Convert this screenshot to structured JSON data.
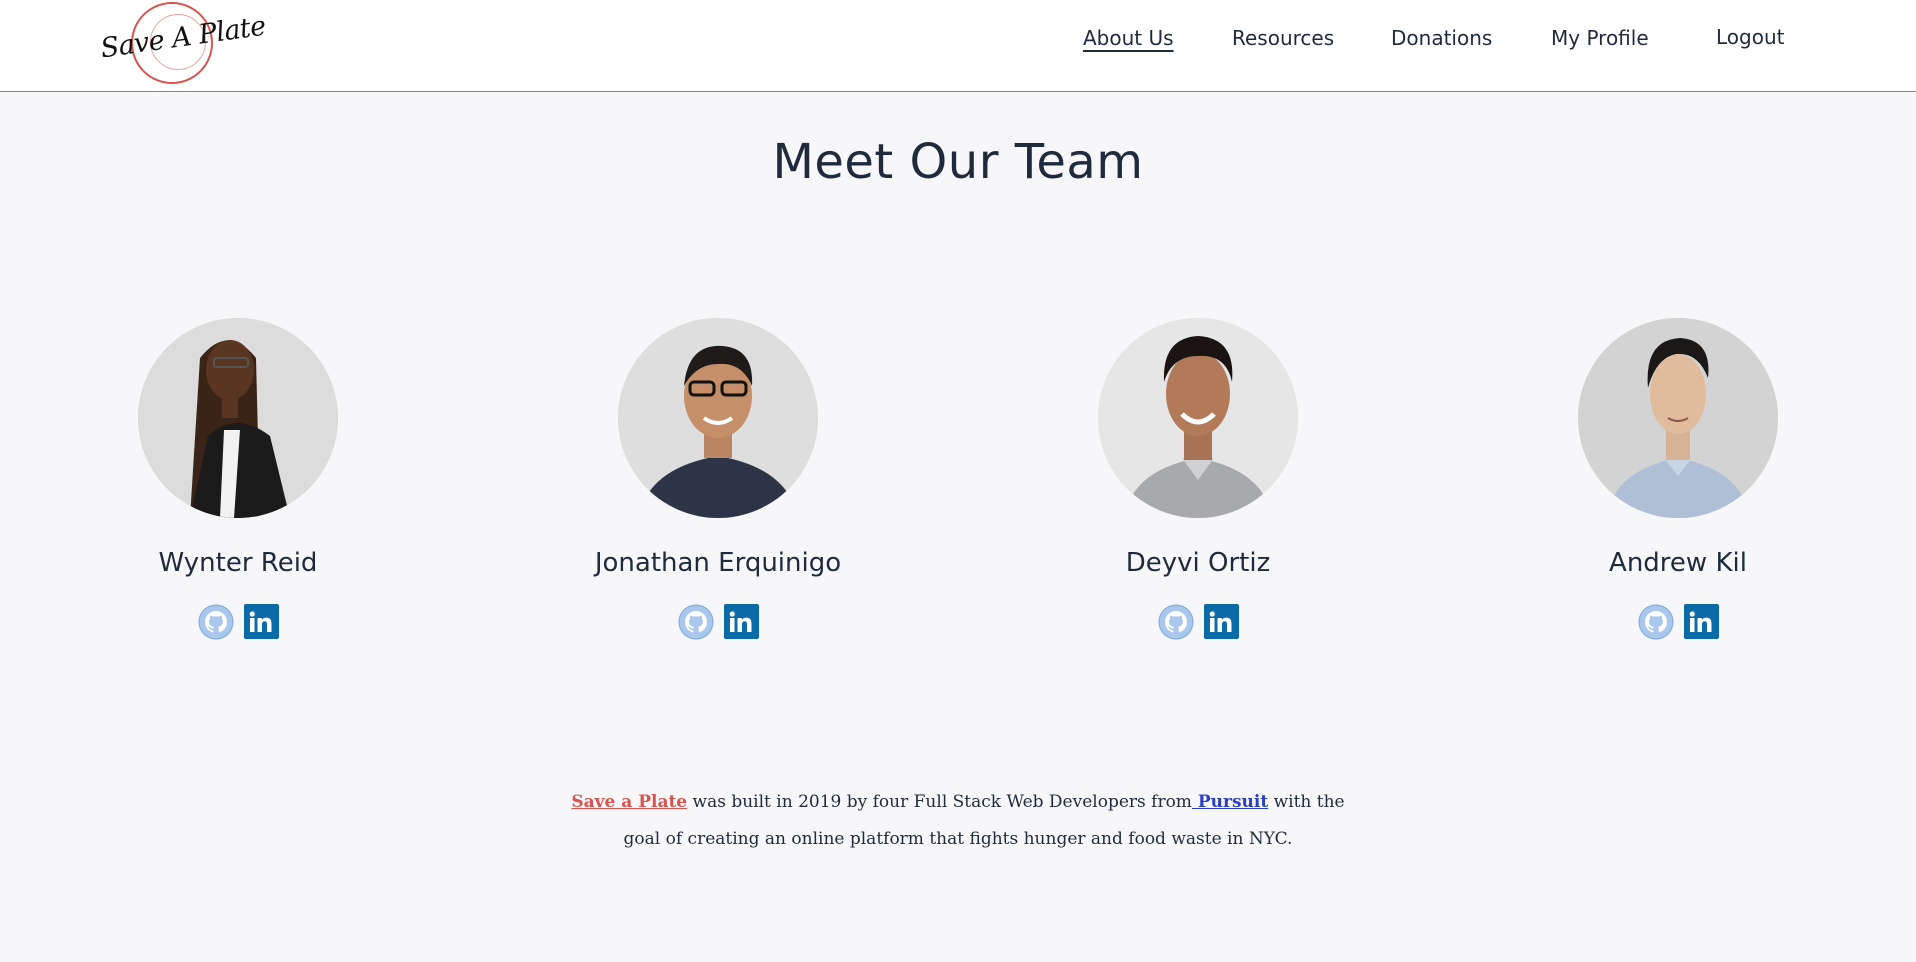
{
  "brand": {
    "logo_text": "Save A Plate",
    "accent_color": "#d9534f"
  },
  "nav": {
    "items": [
      {
        "label": "About Us",
        "active": true
      },
      {
        "label": "Resources",
        "active": false
      },
      {
        "label": "Donations",
        "active": false
      },
      {
        "label": "My Profile",
        "active": false
      },
      {
        "label": "Logout",
        "active": false
      }
    ]
  },
  "main": {
    "title": "Meet Our Team",
    "team": [
      {
        "name": "Wynter Reid",
        "icons": [
          "github-icon",
          "linkedin-icon"
        ]
      },
      {
        "name": "Jonathan Erquinigo",
        "icons": [
          "github-icon",
          "linkedin-icon"
        ]
      },
      {
        "name": "Deyvi Ortiz",
        "icons": [
          "github-icon",
          "linkedin-icon"
        ]
      },
      {
        "name": "Andrew Kil",
        "icons": [
          "github-icon",
          "linkedin-icon"
        ]
      }
    ],
    "about": {
      "brand_link": "Save a Plate",
      "text_1": " was built in 2019 by four Full Stack Web Developers from",
      "pursuit_link": " Pursuit",
      "text_2": " with the goal of creating an online platform that fights hunger and food waste in NYC."
    },
    "link_color": "#2a3fc4",
    "linkedin_color": "#0b6aa8",
    "linkedin_label": "in"
  }
}
